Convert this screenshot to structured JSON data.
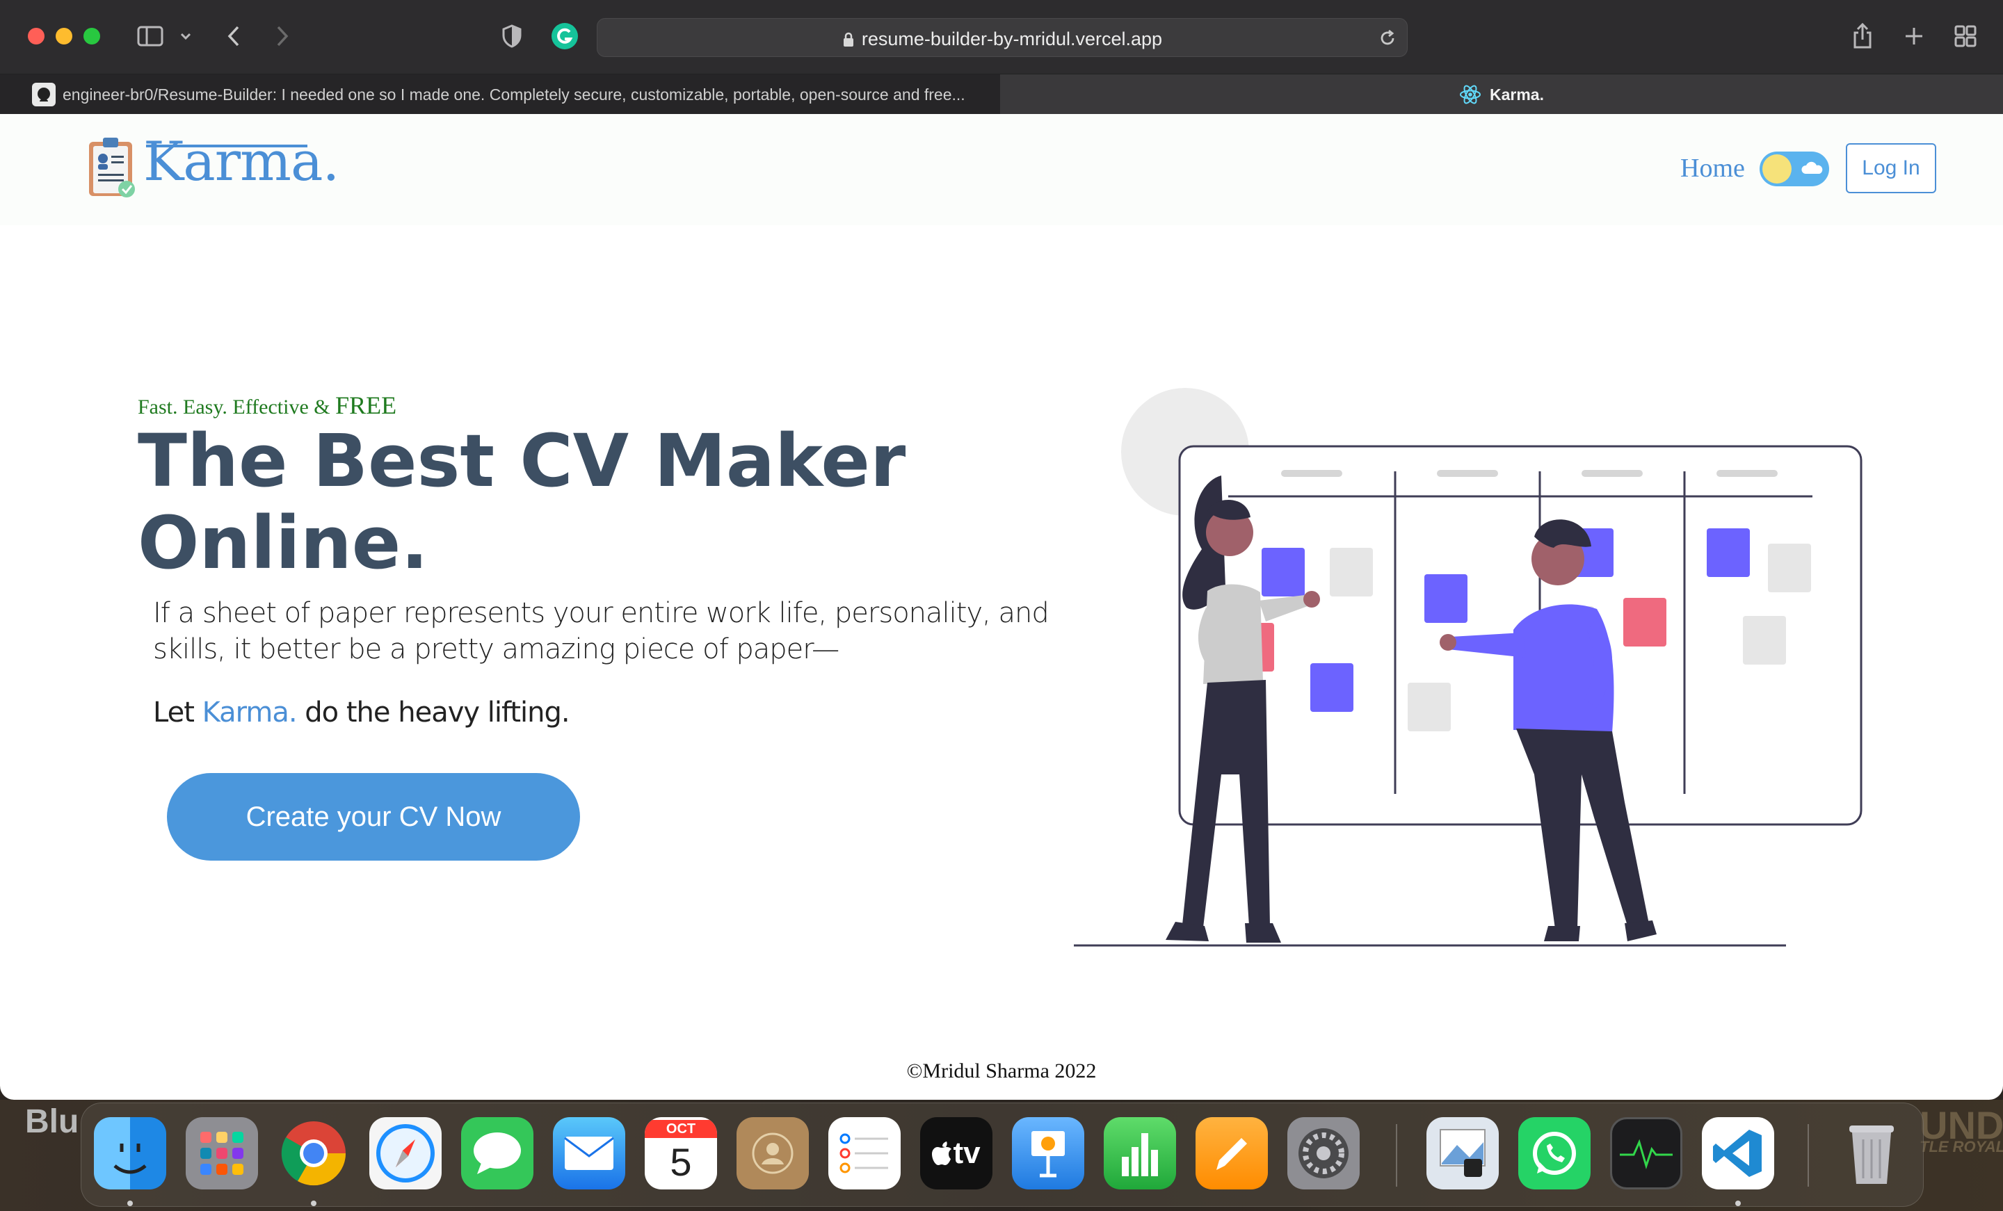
{
  "browser": {
    "url": "resume-builder-by-mridul.vercel.app",
    "tabs": [
      {
        "label": "engineer-br0/Resume-Builder: I needed one so I made one. Completely secure, customizable, portable, open-source and free..."
      },
      {
        "label": "Karma."
      }
    ]
  },
  "header": {
    "logo_text": "Karma.",
    "nav_home": "Home",
    "login_label": "Log In"
  },
  "hero": {
    "tagline": "Fast. Easy. Effective & ",
    "tagline_free": "FREE",
    "headline_line1": "The Best CV Maker",
    "headline_line2": "Online.",
    "description": "If a sheet of paper represents your entire work life, personality, and skills, it better be a pretty amazing piece of paper—",
    "let_prefix": "Let ",
    "let_brand": "Karma.",
    "let_suffix": " do the heavy lifting.",
    "cta_label": "Create your CV Now"
  },
  "footer": {
    "text": "©Mridul Sharma 2022"
  },
  "desktop": {
    "left_text": "Blu",
    "right_text": "UNDS",
    "right_subtext": "TLE ROYAL"
  },
  "dock": {
    "calendar_month": "OCT",
    "calendar_day": "5",
    "tv_label": "tv"
  },
  "colors": {
    "accent": "#4b8fd6",
    "headline": "#3d4f63",
    "tagline": "#1f7a1f",
    "cta": "#4b97dc"
  }
}
